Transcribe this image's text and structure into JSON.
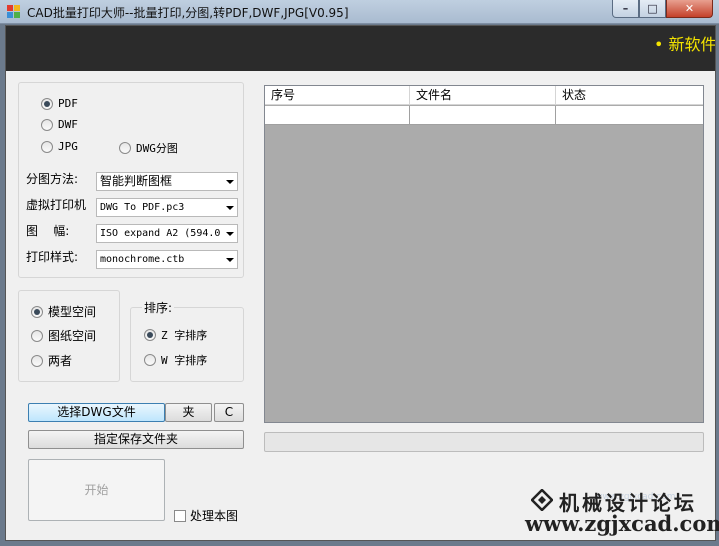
{
  "window": {
    "title": "CAD批量打印大师--批量打印,分图,转PDF,DWF,JPG[V0.95]",
    "controls": {
      "minimize": "–",
      "maximize": "□",
      "close": "✕"
    }
  },
  "banner": {
    "ticker": "• 新软件"
  },
  "format_group": {
    "options": [
      "PDF",
      "DWF",
      "JPG",
      "DWG分图"
    ],
    "selected": "PDF"
  },
  "settings": {
    "split_method": {
      "label": "分图方法:",
      "value": "智能判断图框"
    },
    "printer": {
      "label": "虚拟打印机",
      "value": "DWG To PDF.pc3"
    },
    "paper": {
      "label": "图    幅:",
      "value": "ISO expand A2 (594.0"
    },
    "style": {
      "label": "打印样式:",
      "value": "monochrome.ctb"
    }
  },
  "space_group": {
    "options": [
      "模型空间",
      "图纸空间",
      "两者"
    ],
    "selected": "模型空间"
  },
  "sort_group": {
    "legend": "排序:",
    "options": [
      "Z 字排序",
      "W 字排序"
    ],
    "selected": "Z 字排序"
  },
  "buttons": {
    "select_dwg": "选择DWG文件",
    "folder": "夹",
    "clear": "C",
    "save_folder": "指定保存文件夹",
    "start": "开始"
  },
  "process_checkbox": {
    "label": "处理本图",
    "checked": false
  },
  "table": {
    "columns": [
      "序号",
      "文件名",
      "状态"
    ],
    "rows": [
      [
        "",
        "",
        ""
      ]
    ]
  },
  "progress": {
    "value": 0
  },
  "watermark": {
    "site_name": "机械设计论坛",
    "url": "www.zgjxcad.com",
    "faint": "www.zgjxcad.com"
  },
  "colors": {
    "banner_bg": "#2b2b2b",
    "ticker": "#f5e400",
    "grid_bg": "#ababab",
    "titlebar": "#b4c5d9",
    "close_button": "#c4412a"
  }
}
